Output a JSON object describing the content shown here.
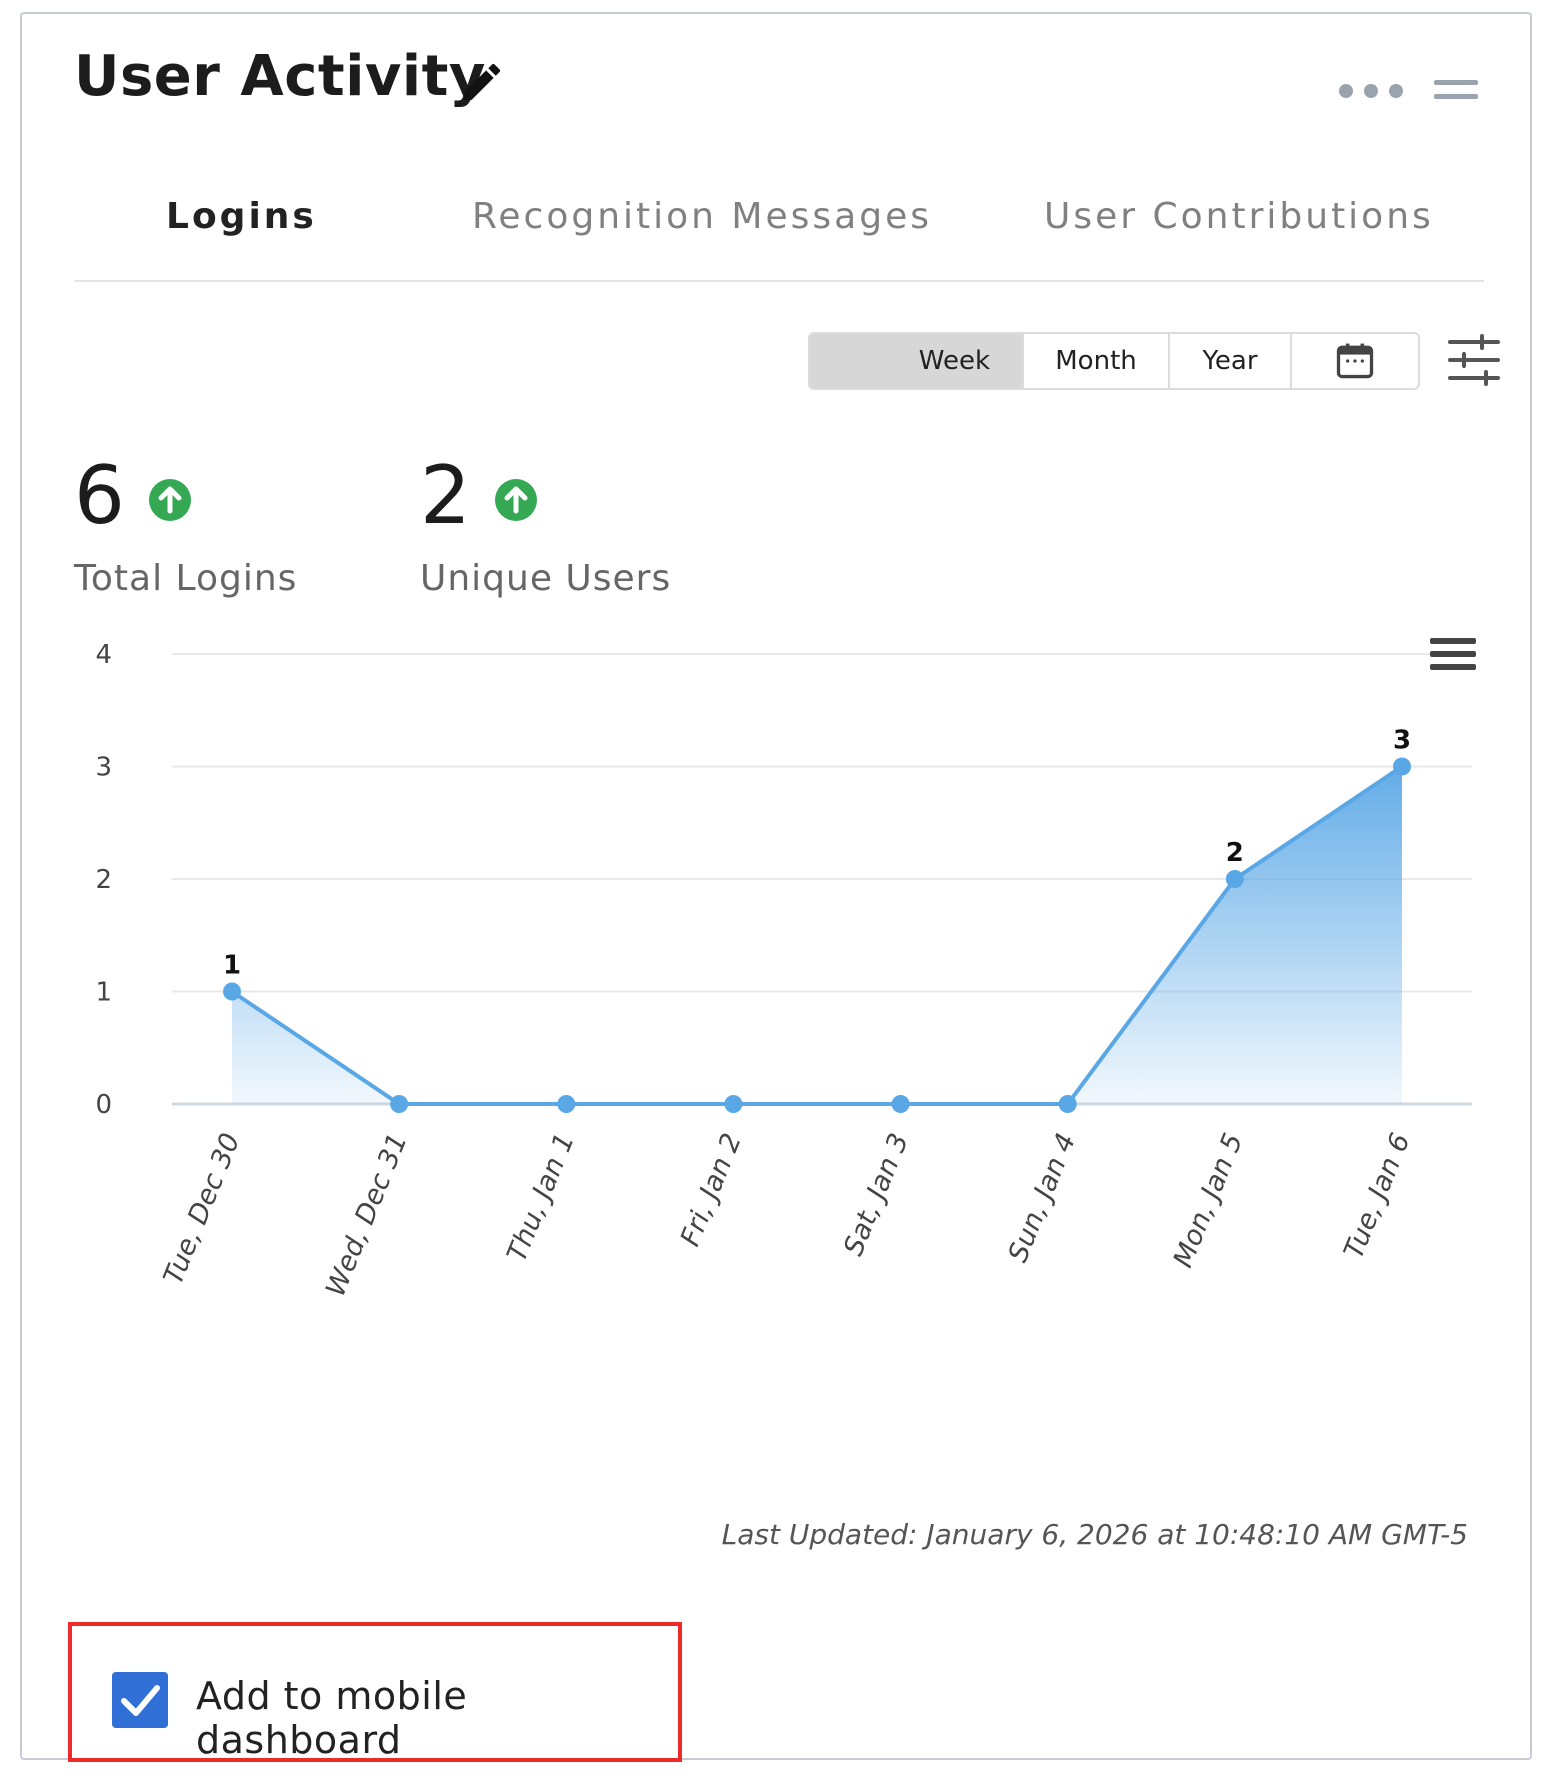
{
  "header": {
    "title": "User Activity"
  },
  "tabs": [
    {
      "label": "Logins",
      "active": true
    },
    {
      "label": "Recognition Messages",
      "active": false
    },
    {
      "label": "User Contributions",
      "active": false
    }
  ],
  "period": {
    "options": [
      "Week",
      "Month",
      "Year"
    ],
    "selected": "Week"
  },
  "kpis": [
    {
      "value": "6",
      "label": "Total Logins",
      "trend": "up"
    },
    {
      "value": "2",
      "label": "Unique Users",
      "trend": "up"
    }
  ],
  "colors": {
    "accent": "#5aa7e6",
    "trend_up": "#35a853",
    "checkbox": "#2f6fd6",
    "highlight": "#ee2a2a"
  },
  "chart_data": {
    "type": "area",
    "categories": [
      "Tue, Dec 30",
      "Wed, Dec 31",
      "Thu, Jan 1",
      "Fri, Jan 2",
      "Sat, Jan 3",
      "Sun, Jan 4",
      "Mon, Jan 5",
      "Tue, Jan 6"
    ],
    "values": [
      1,
      0,
      0,
      0,
      0,
      0,
      2,
      3
    ],
    "data_labels": [
      "1",
      "",
      "",
      "",
      "",
      "",
      "2",
      "3"
    ],
    "yticks": [
      "0",
      "1",
      "2",
      "3",
      "4"
    ],
    "ylim": [
      0,
      4
    ],
    "grid": true
  },
  "footer": {
    "last_updated": "Last Updated: January 6, 2026 at 10:48:10 AM GMT-5",
    "mobile_label": "Add to mobile dashboard",
    "mobile_checked": true
  }
}
